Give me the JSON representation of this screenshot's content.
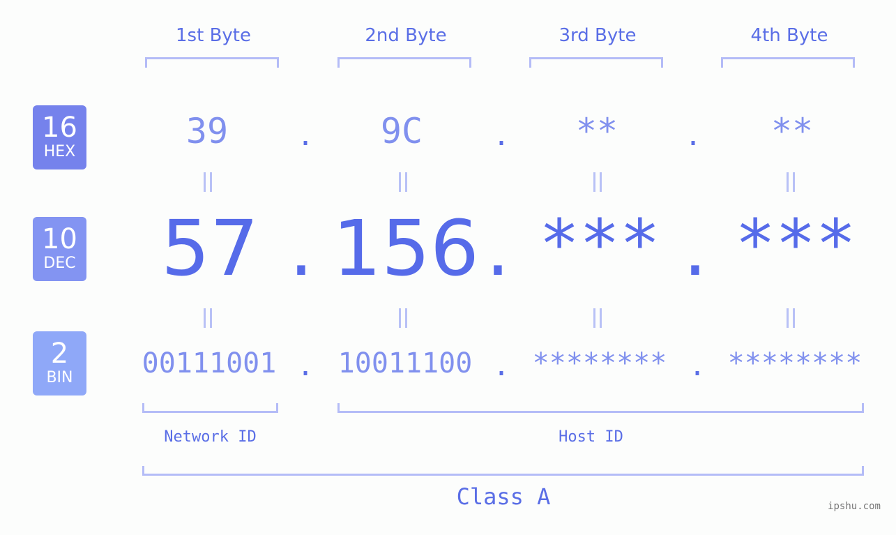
{
  "headers": [
    "1st Byte",
    "2nd Byte",
    "3rd Byte",
    "4th Byte"
  ],
  "bases": {
    "hex": {
      "num": "16",
      "label": "HEX",
      "color": "#7582ec"
    },
    "dec": {
      "num": "10",
      "label": "DEC",
      "color": "#8394f2"
    },
    "bin": {
      "num": "2",
      "label": "BIN",
      "color": "#8fa8f8"
    }
  },
  "separator": ".",
  "hex_values": [
    "39",
    "9C",
    "**",
    "**"
  ],
  "dec_values": [
    "57",
    "156",
    "***",
    "***"
  ],
  "bin_values": [
    "00111001",
    "10011100",
    "********",
    "********"
  ],
  "parts": {
    "network": "Network ID",
    "host": "Host ID",
    "class": "Class A"
  },
  "watermark": "ipshu.com",
  "colors": {
    "accent": "#566be9",
    "light_accent": "#8090ee",
    "bracket": "#b4bcf7",
    "background": "#fcfdfc"
  }
}
